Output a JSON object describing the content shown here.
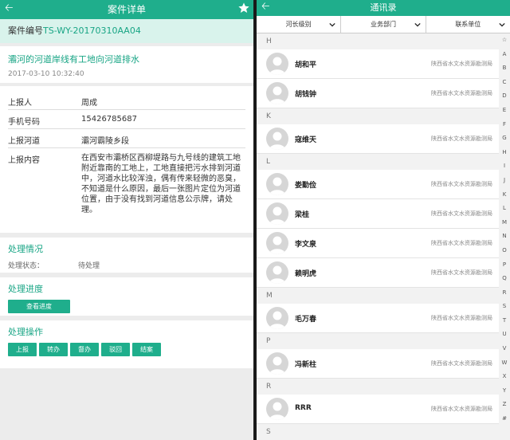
{
  "case": {
    "header_title": "案件详单",
    "case_no_label": "案件编号",
    "case_no": "TS-WY-20170310AA04",
    "event_title": "灞河的河道岸线有工地向河道排水",
    "event_time": "2017-03-10 10:32:40",
    "info": {
      "reporter_label": "上报人",
      "reporter": "周成",
      "phone_label": "手机号码",
      "phone": "15426785687",
      "river_label": "上报河道",
      "river": "灞河霸陵乡段",
      "content_label": "上报内容",
      "content": "在西安市灞桥区西柳堤路与九号线的建筑工地附近靠南的工地上，工地直接把污水排到河道中，河道水比较浑浊，偶有传来轻微的恶臭，不知道是什么原因，最后一张图片定位为河道位置，由于没有找到河道信息公示牌，请处理。"
    },
    "status_section_title": "处理情况",
    "status_label": "处理状态：",
    "status_value": "待处理",
    "progress_section_title": "处理进度",
    "progress_button": "查看进度",
    "ops_section_title": "处理操作",
    "ops_buttons": [
      "上报",
      "转办",
      "督办",
      "驳回",
      "结案"
    ]
  },
  "contacts": {
    "header_title": "通讯录",
    "filters": [
      "河长级别",
      "业务部门",
      "联系单位"
    ],
    "groups": [
      {
        "letter": "H",
        "people": [
          {
            "name": "胡和平",
            "org": "陕西省水文水资源勘测局"
          },
          {
            "name": "胡钱钟",
            "org": "陕西省水文水资源勘测局"
          }
        ]
      },
      {
        "letter": "K",
        "people": [
          {
            "name": "寇维天",
            "org": "陕西省水文水资源勘测局"
          }
        ]
      },
      {
        "letter": "L",
        "people": [
          {
            "name": "娄勤俭",
            "org": "陕西省水文水资源勘测局"
          },
          {
            "name": "梁桂",
            "org": "陕西省水文水资源勘测局"
          },
          {
            "name": "李文泉",
            "org": "陕西省水文水资源勘测局"
          },
          {
            "name": "赖明虎",
            "org": "陕西省水文水资源勘测局"
          }
        ]
      },
      {
        "letter": "M",
        "people": [
          {
            "name": "毛万春",
            "org": "陕西省水文水资源勘测局"
          }
        ]
      },
      {
        "letter": "P",
        "people": [
          {
            "name": "冯新柱",
            "org": "陕西省水文水资源勘测局"
          }
        ]
      },
      {
        "letter": "R",
        "people": [
          {
            "name": "RRR",
            "org": "陕西省水文水资源勘测局"
          }
        ]
      },
      {
        "letter": "S",
        "people": []
      }
    ],
    "alphabet": [
      "☆",
      "A",
      "B",
      "C",
      "D",
      "E",
      "F",
      "G",
      "H",
      "I",
      "J",
      "K",
      "L",
      "M",
      "N",
      "O",
      "P",
      "Q",
      "R",
      "S",
      "T",
      "U",
      "V",
      "W",
      "X",
      "Y",
      "Z",
      "#"
    ]
  },
  "colors": {
    "accent": "#1fae8c",
    "accent_light": "#d9f3ec"
  },
  "icons": {
    "back": "back-arrow-icon",
    "favorite": "star-icon",
    "dropdown": "chevron-down-icon",
    "avatar": "user-avatar-icon"
  }
}
